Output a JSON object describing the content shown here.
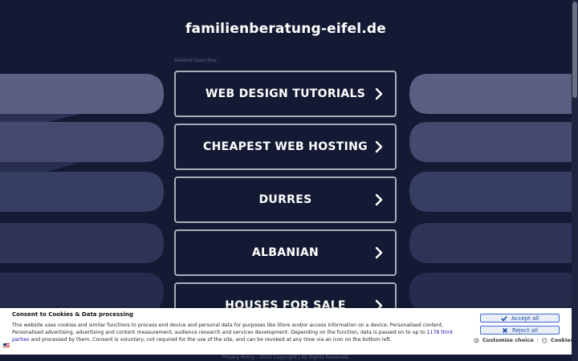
{
  "page": {
    "title": "familienberatung-eifel.de",
    "related_label": "Related Searches:"
  },
  "links": [
    {
      "label": "WEB DESIGN TUTORIALS"
    },
    {
      "label": "CHEAPEST WEB HOSTING"
    },
    {
      "label": "DURRES"
    },
    {
      "label": "ALBANIAN"
    },
    {
      "label": "HOUSES FOR SALE"
    }
  ],
  "footer": {
    "privacy": "Privacy Policy",
    "copyright": "2025 Copyright | All Rights Reserved."
  },
  "consent": {
    "title": "Consent to Cookies & Data processing",
    "text_part1": "This website uses cookies and similar functions to process end device and personal data for purposes like Store and/or access information on a device, Personalised content, Personalised advertising, advertising and content measurement, audience research and services development. Depending on the function, data is passed on to up to ",
    "third_parties": "1178 third parties",
    "text_part2": " and processed by them. Consent is voluntary, not required for the use of the site, and can be revoked at any time via an icon on the bottom left.",
    "accept_label": "Accept all",
    "reject_label": "Reject all",
    "customize_label": "Customize choice",
    "separator": "|",
    "cookies_label": "Cookies"
  },
  "colors": {
    "background": "#141a33",
    "deco_light": "#596081",
    "deco_dark": "#252c4d",
    "button_border": "#a9adba",
    "accent_blue": "#1d4aa8"
  },
  "icons": {
    "link_chevron": "chevron-right-icon",
    "accept": "check-icon",
    "reject": "x-icon",
    "customize": "gear-icon",
    "cookies": "cookie-icon",
    "flag": "flag-icon"
  }
}
